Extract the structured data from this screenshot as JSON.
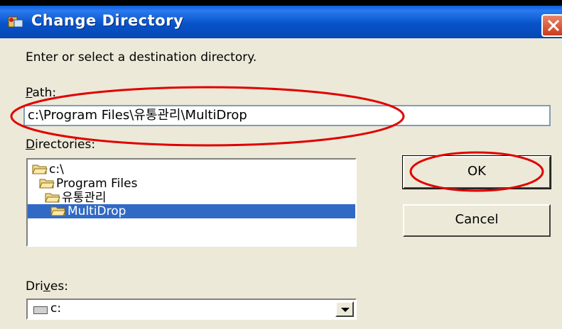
{
  "dialog": {
    "title": "Change Directory",
    "prompt": "Enter or select a destination directory.",
    "path_label_first": "P",
    "path_label_rest": "ath:",
    "path_value": "c:\\Program Files\\유통관리\\MultiDrop",
    "directories_label_first": "D",
    "directories_label_rest": "irectories:",
    "directories": [
      {
        "label": "c:\\",
        "selected": false
      },
      {
        "label": "Program Files",
        "selected": false
      },
      {
        "label": "유통관리",
        "selected": false
      },
      {
        "label": "MultiDrop",
        "selected": true
      }
    ],
    "ok_label": "OK",
    "cancel_label": "Cancel",
    "drives_label_pre": "Dri",
    "drives_label_u": "v",
    "drives_label_post": "es:",
    "drive_value": "c:"
  },
  "colors": {
    "title_bar": "#0853c9",
    "selection": "#316ac5",
    "annotation": "#e00000"
  }
}
